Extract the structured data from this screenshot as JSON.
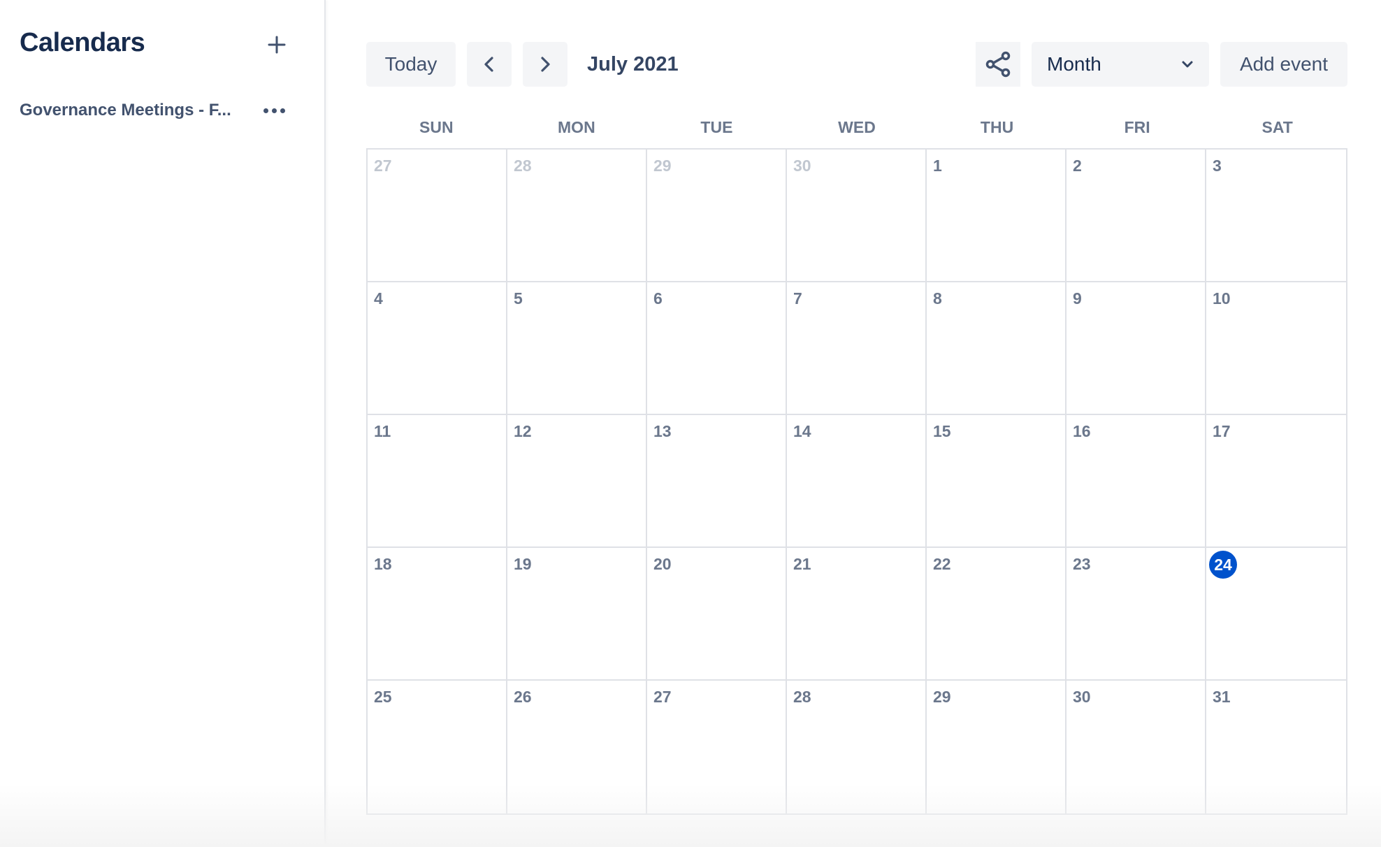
{
  "sidebar": {
    "title": "Calendars",
    "add_icon": "plus-icon",
    "calendars": [
      {
        "label": "Governance Meetings - F...",
        "menu_icon": "more-horizontal-icon"
      }
    ]
  },
  "toolbar": {
    "today_label": "Today",
    "prev_icon": "chevron-left-icon",
    "next_icon": "chevron-right-icon",
    "current_period": "July 2021",
    "share_icon": "share-icon",
    "view_selected": "Month",
    "view_chevron_icon": "chevron-down-icon",
    "add_event_label": "Add event"
  },
  "calendar": {
    "weekdays": [
      "SUN",
      "MON",
      "TUE",
      "WED",
      "THU",
      "FRI",
      "SAT"
    ],
    "today": 24,
    "accent_color": "#0052cc",
    "weeks": [
      [
        {
          "d": "27",
          "out": true
        },
        {
          "d": "28",
          "out": true
        },
        {
          "d": "29",
          "out": true
        },
        {
          "d": "30",
          "out": true
        },
        {
          "d": "1"
        },
        {
          "d": "2"
        },
        {
          "d": "3"
        }
      ],
      [
        {
          "d": "4"
        },
        {
          "d": "5"
        },
        {
          "d": "6"
        },
        {
          "d": "7"
        },
        {
          "d": "8"
        },
        {
          "d": "9"
        },
        {
          "d": "10"
        }
      ],
      [
        {
          "d": "11"
        },
        {
          "d": "12"
        },
        {
          "d": "13"
        },
        {
          "d": "14"
        },
        {
          "d": "15"
        },
        {
          "d": "16"
        },
        {
          "d": "17"
        }
      ],
      [
        {
          "d": "18"
        },
        {
          "d": "19"
        },
        {
          "d": "20"
        },
        {
          "d": "21"
        },
        {
          "d": "22"
        },
        {
          "d": "23"
        },
        {
          "d": "24",
          "today": true
        }
      ],
      [
        {
          "d": "25"
        },
        {
          "d": "26"
        },
        {
          "d": "27"
        },
        {
          "d": "28"
        },
        {
          "d": "29"
        },
        {
          "d": "30"
        },
        {
          "d": "31"
        }
      ]
    ]
  }
}
